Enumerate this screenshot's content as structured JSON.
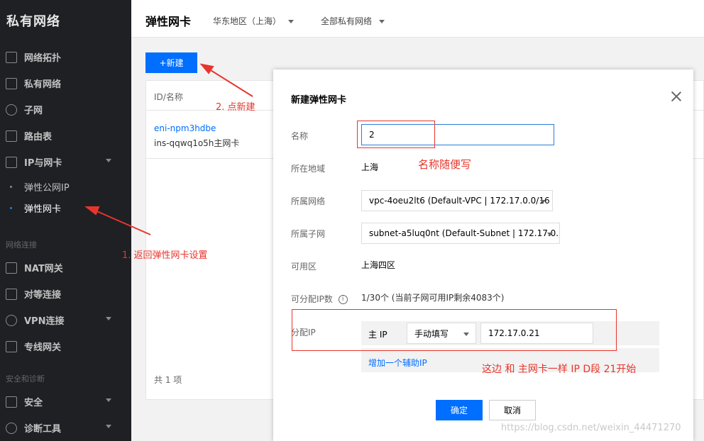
{
  "sidebar": {
    "title": "私有网络",
    "items": [
      {
        "label": "网络拓扑",
        "icon": "topology-icon"
      },
      {
        "label": "私有网络",
        "icon": "lock-icon"
      },
      {
        "label": "子网",
        "icon": "globe-icon"
      },
      {
        "label": "路由表",
        "icon": "route-table-icon"
      },
      {
        "label": "IP与网卡",
        "icon": "ip-nic-icon"
      }
    ],
    "sub_items": [
      {
        "label": "弹性公网IP"
      },
      {
        "label": "弹性网卡"
      }
    ],
    "group_network": "网络连接",
    "items2": [
      {
        "label": "NAT网关"
      },
      {
        "label": "对等连接"
      },
      {
        "label": "VPN连接"
      },
      {
        "label": "专线网关"
      }
    ],
    "group_security": "安全和诊断",
    "items3": [
      {
        "label": "安全"
      },
      {
        "label": "诊断工具"
      }
    ]
  },
  "header": {
    "title": "弹性网卡",
    "region": "华东地区（上海）",
    "vpc_filter": "全部私有网络"
  },
  "toolbar": {
    "new_label": "+新建"
  },
  "table": {
    "column_id": "ID/名称",
    "rows": [
      {
        "id": "eni-npm3hdbe",
        "name": "ins-qqwq1o5h主网卡"
      }
    ],
    "footer": "共 1 项"
  },
  "modal": {
    "title": "新建弹性网卡",
    "name_label": "名称",
    "name_value": "2",
    "region_label": "所在地域",
    "region_value": "上海",
    "vpc_label": "所属网络",
    "vpc_value": "vpc-4oeu2lt6 (Default-VPC | 172.17.0.0/16",
    "subnet_label": "所属子网",
    "subnet_value": "subnet-a5luq0nt (Default-Subnet | 172.17.0.(",
    "zone_label": "可用区",
    "zone_value": "上海四区",
    "ip_count_label": "可分配IP数",
    "ip_count_value": "1/30个 (当前子网可用IP剩余4083个)",
    "assign_ip_label": "分配IP",
    "primary_ip_label": "主 IP",
    "ip_mode": "手动填写",
    "ip_value": "172.17.0.21",
    "add_secondary": "增加一个辅助IP",
    "ok_label": "确定",
    "cancel_label": "取消"
  },
  "annotations": {
    "a1": "1. 返回弹性网卡设置",
    "a2": "2. 点新建",
    "a3": "名称随便写",
    "a4": "这边 和 主网卡一样 IP D段 21开始"
  },
  "watermark": "https://blog.csdn.net/weixin_44471270",
  "colors": {
    "accent": "#006eff",
    "annotation": "#e8352b",
    "sidebar": "#1e2024"
  }
}
